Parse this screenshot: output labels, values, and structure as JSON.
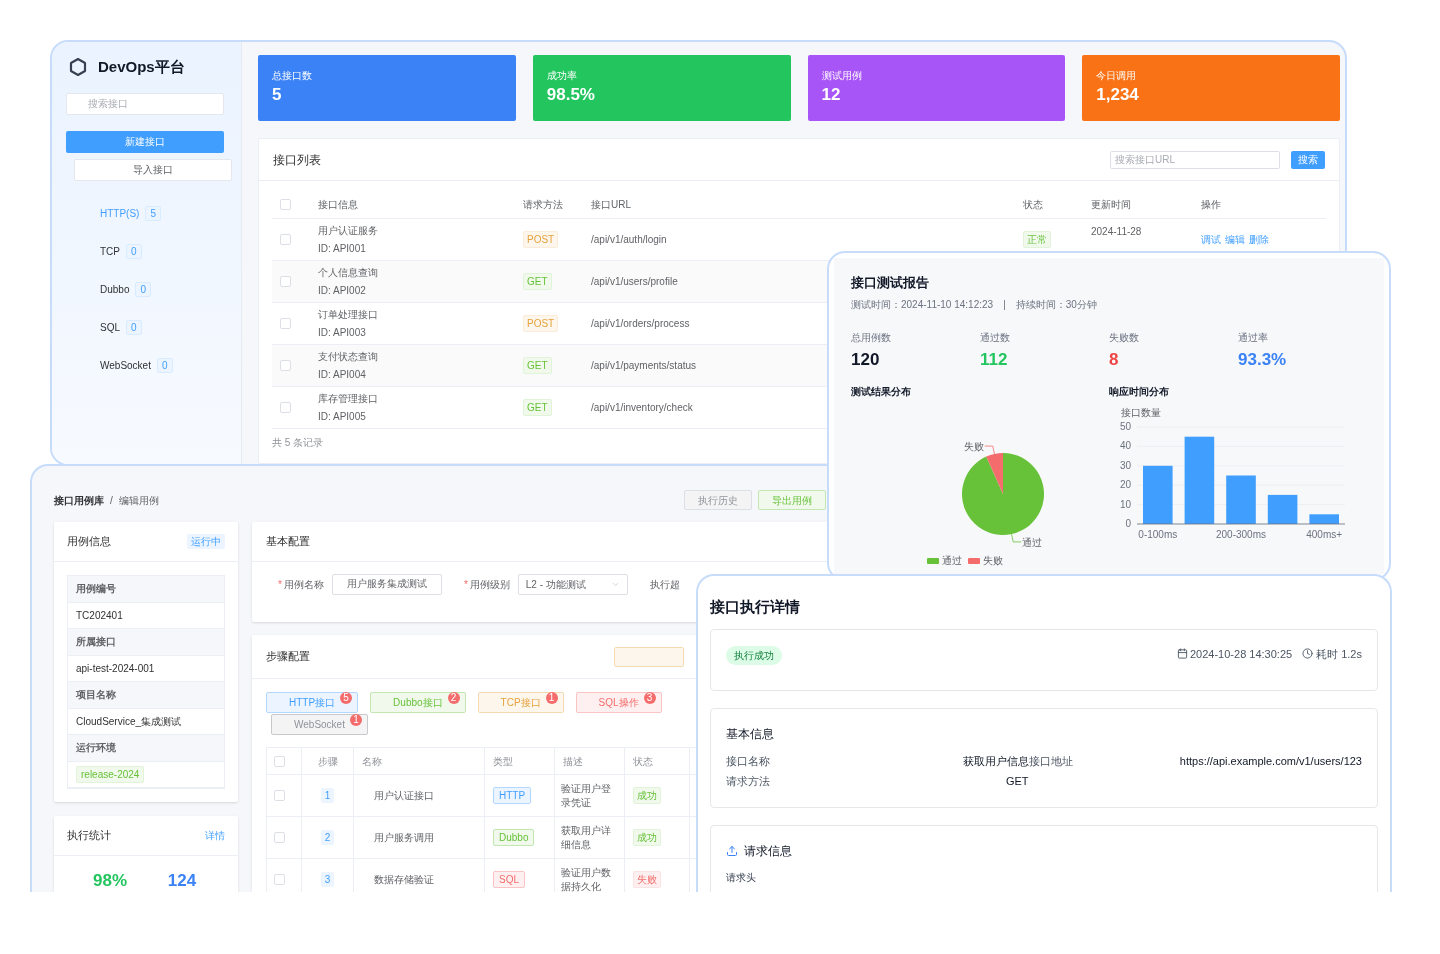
{
  "main_window": {
    "logo": "DevOps平台",
    "search": {
      "placeholder": "搜索接口"
    },
    "new_button": "新建接口",
    "import_button": "导入接口",
    "nav": [
      {
        "label": "HTTP(S)",
        "count": "5",
        "selected": true
      },
      {
        "label": "TCP",
        "count": "0",
        "selected": false
      },
      {
        "label": "Dubbo",
        "count": "0",
        "selected": false
      },
      {
        "label": "SQL",
        "count": "0",
        "selected": false
      },
      {
        "label": "WebSocket",
        "count": "0",
        "selected": false
      }
    ],
    "stats": [
      {
        "label": "总接口数",
        "value": "5",
        "color": "#3b82f6"
      },
      {
        "label": "成功率",
        "value": "98.5%",
        "color": "#22c55e"
      },
      {
        "label": "测试用例",
        "value": "12",
        "color": "#a855f7"
      },
      {
        "label": "今日调用",
        "value": "1,234",
        "color": "#f97316"
      }
    ],
    "list": {
      "title": "接口列表",
      "search": {
        "placeholder": "搜索接口URL"
      },
      "search_button": "搜索",
      "select_all": {
        "checked": false
      },
      "columns": [
        "接口信息",
        "请求方法",
        "接口URL",
        "状态",
        "更新时间",
        "操作"
      ],
      "rows": [
        {
          "checked": false,
          "name": "用户认证服务",
          "id": "ID: API001",
          "method": "POST",
          "url": "/api/v1/auth/login",
          "status": "正常",
          "time": "2024-11-28",
          "actions": [
            "调试",
            "编辑",
            "删除"
          ]
        },
        {
          "checked": false,
          "name": "个人信息查询",
          "id": "ID: API002",
          "method": "GET",
          "url": "/api/v1/users/profile"
        },
        {
          "checked": false,
          "name": "订单处理接口",
          "id": "ID: API003",
          "method": "POST",
          "url": "/api/v1/orders/process"
        },
        {
          "checked": false,
          "name": "支付状态查询",
          "id": "ID: API004",
          "method": "GET",
          "url": "/api/v1/payments/status"
        },
        {
          "checked": false,
          "name": "库存管理接口",
          "id": "ID: API005",
          "method": "GET",
          "url": "/api/v1/inventory/check"
        }
      ],
      "footer": "共 5 条记录"
    }
  },
  "case_window": {
    "breadcrumb": {
      "items": [
        "接口用例库",
        "编辑用例"
      ],
      "separator": "/"
    },
    "buttons": [
      {
        "label": "执行历史",
        "kind": "default"
      },
      {
        "label": "导出用例",
        "kind": "success"
      }
    ],
    "case_info": {
      "title": "用例信息",
      "status": "运行中",
      "fields": [
        {
          "label": "用例编号",
          "value": "TC202401",
          "kind": "text"
        },
        {
          "label": "所属接口",
          "value": "api-test-2024-001",
          "kind": "text"
        },
        {
          "label": "项目名称",
          "value": "CloudService_集成测试",
          "kind": "text"
        },
        {
          "label": "运行环境",
          "value": "release-2024",
          "kind": "tag"
        }
      ]
    },
    "exec_stats": {
      "title": "执行统计",
      "link": "详情",
      "values": [
        {
          "value": "98%",
          "kind": "success"
        },
        {
          "value": "124",
          "kind": "primary"
        }
      ]
    },
    "basic_config": {
      "title": "基本配置",
      "fields": [
        {
          "label": "用例名称",
          "required_mark": "*",
          "value": "用户服务集成测试",
          "kind": "input"
        },
        {
          "label": "用例级别",
          "required_mark": "*",
          "value": "L2 - 功能测试",
          "kind": "select"
        },
        {
          "label": "执行超",
          "kind": "label"
        }
      ]
    },
    "steps": {
      "title": "步骤配置",
      "tabs": [
        {
          "label": "HTTP接口",
          "count": "5",
          "kind": "http"
        },
        {
          "label": "Dubbo接口",
          "count": "2",
          "kind": "dubbo"
        },
        {
          "label": "TCP接口",
          "count": "1",
          "kind": "tcp"
        },
        {
          "label": "SQL操作",
          "count": "3",
          "kind": "sql"
        },
        {
          "label": "WebSocket",
          "count": "1",
          "kind": "websocket"
        }
      ],
      "select_all": {
        "checked": false
      },
      "columns": [
        "步骤",
        "名称",
        "类型",
        "描述",
        "状态"
      ],
      "rows": [
        {
          "checked": false,
          "step": "1",
          "name": "用户认证接口",
          "type": {
            "label": "HTTP",
            "kind": "http"
          },
          "desc": "验证用户登录凭证",
          "status": {
            "label": "成功",
            "kind": "success"
          }
        },
        {
          "checked": false,
          "step": "2",
          "name": "用户服务调用",
          "type": {
            "label": "Dubbo",
            "kind": "dubbo"
          },
          "desc": "获取用户详细信息",
          "status": {
            "label": "成功",
            "kind": "success"
          }
        },
        {
          "checked": false,
          "step": "3",
          "name": "数据存储验证",
          "type": {
            "label": "SQL",
            "kind": "sql"
          },
          "desc": "验证用户数据持久化",
          "status": {
            "label": "失败",
            "kind": "fail"
          }
        }
      ]
    }
  },
  "report_window": {
    "title": "接口测试报告",
    "test_time": "测试时间：2024-11-10 14:12:23",
    "separator": "|",
    "duration": "持续时间：30分钟",
    "stats": [
      {
        "label": "总用例数",
        "value": "120",
        "kind": "neutral"
      },
      {
        "label": "通过数",
        "value": "112",
        "kind": "success"
      },
      {
        "label": "失败数",
        "value": "8",
        "kind": "fail"
      },
      {
        "label": "通过率",
        "value": "93.3%",
        "kind": "primary"
      }
    ],
    "pie": {
      "chart_data": {
        "type": "pie",
        "title": "测试结果分布",
        "categories": [
          "通过",
          "失败"
        ],
        "values": [
          93.3,
          6.7
        ]
      },
      "legend": [
        {
          "label": "通过",
          "color": "#67c23a"
        },
        {
          "label": "失败",
          "color": "#f56c6c"
        }
      ]
    },
    "bars": {
      "chart_data": {
        "type": "bar",
        "title": "响应时间分布",
        "ylabel": "接口数量",
        "categories": [
          "0-100ms",
          null,
          "200-300ms",
          null,
          "400ms+"
        ],
        "ylim": [
          0,
          50
        ],
        "grid": true,
        "yticks": [
          0,
          10,
          20,
          30,
          40,
          50
        ],
        "series": [
          {
            "color": "#409eff",
            "values": [
              30,
              45,
              25,
              15,
              5
            ]
          }
        ]
      }
    }
  },
  "detail_window": {
    "title": "接口执行详情",
    "status": "执行成功",
    "datetime": "2024-10-28 14:30:25",
    "elapsed": "耗时 1.2s",
    "basic": {
      "title": "基本信息",
      "fields": [
        {
          "label": "接口名称",
          "value": "获取用户信息"
        },
        {
          "label": "接口地址",
          "value": "https://api.example.com/v1/users/123"
        },
        {
          "label": "请求方法",
          "value": "GET"
        }
      ]
    },
    "request": {
      "title": "请求信息",
      "headers_label": "请求头"
    }
  }
}
